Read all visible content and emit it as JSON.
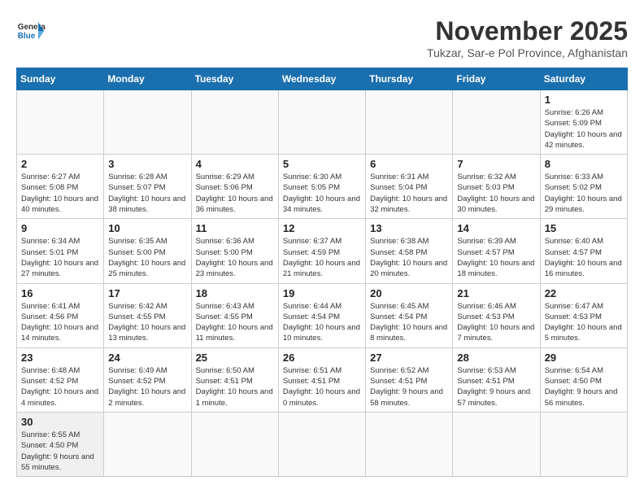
{
  "logo": {
    "general": "General",
    "blue": "Blue"
  },
  "title": "November 2025",
  "subtitle": "Tukzar, Sar-e Pol Province, Afghanistan",
  "days_of_week": [
    "Sunday",
    "Monday",
    "Tuesday",
    "Wednesday",
    "Thursday",
    "Friday",
    "Saturday"
  ],
  "weeks": [
    [
      {
        "day": "",
        "info": ""
      },
      {
        "day": "",
        "info": ""
      },
      {
        "day": "",
        "info": ""
      },
      {
        "day": "",
        "info": ""
      },
      {
        "day": "",
        "info": ""
      },
      {
        "day": "",
        "info": ""
      },
      {
        "day": "1",
        "info": "Sunrise: 6:26 AM\nSunset: 5:09 PM\nDaylight: 10 hours and 42 minutes."
      }
    ],
    [
      {
        "day": "2",
        "info": "Sunrise: 6:27 AM\nSunset: 5:08 PM\nDaylight: 10 hours and 40 minutes."
      },
      {
        "day": "3",
        "info": "Sunrise: 6:28 AM\nSunset: 5:07 PM\nDaylight: 10 hours and 38 minutes."
      },
      {
        "day": "4",
        "info": "Sunrise: 6:29 AM\nSunset: 5:06 PM\nDaylight: 10 hours and 36 minutes."
      },
      {
        "day": "5",
        "info": "Sunrise: 6:30 AM\nSunset: 5:05 PM\nDaylight: 10 hours and 34 minutes."
      },
      {
        "day": "6",
        "info": "Sunrise: 6:31 AM\nSunset: 5:04 PM\nDaylight: 10 hours and 32 minutes."
      },
      {
        "day": "7",
        "info": "Sunrise: 6:32 AM\nSunset: 5:03 PM\nDaylight: 10 hours and 30 minutes."
      },
      {
        "day": "8",
        "info": "Sunrise: 6:33 AM\nSunset: 5:02 PM\nDaylight: 10 hours and 29 minutes."
      }
    ],
    [
      {
        "day": "9",
        "info": "Sunrise: 6:34 AM\nSunset: 5:01 PM\nDaylight: 10 hours and 27 minutes."
      },
      {
        "day": "10",
        "info": "Sunrise: 6:35 AM\nSunset: 5:00 PM\nDaylight: 10 hours and 25 minutes."
      },
      {
        "day": "11",
        "info": "Sunrise: 6:36 AM\nSunset: 5:00 PM\nDaylight: 10 hours and 23 minutes."
      },
      {
        "day": "12",
        "info": "Sunrise: 6:37 AM\nSunset: 4:59 PM\nDaylight: 10 hours and 21 minutes."
      },
      {
        "day": "13",
        "info": "Sunrise: 6:38 AM\nSunset: 4:58 PM\nDaylight: 10 hours and 20 minutes."
      },
      {
        "day": "14",
        "info": "Sunrise: 6:39 AM\nSunset: 4:57 PM\nDaylight: 10 hours and 18 minutes."
      },
      {
        "day": "15",
        "info": "Sunrise: 6:40 AM\nSunset: 4:57 PM\nDaylight: 10 hours and 16 minutes."
      }
    ],
    [
      {
        "day": "16",
        "info": "Sunrise: 6:41 AM\nSunset: 4:56 PM\nDaylight: 10 hours and 14 minutes."
      },
      {
        "day": "17",
        "info": "Sunrise: 6:42 AM\nSunset: 4:55 PM\nDaylight: 10 hours and 13 minutes."
      },
      {
        "day": "18",
        "info": "Sunrise: 6:43 AM\nSunset: 4:55 PM\nDaylight: 10 hours and 11 minutes."
      },
      {
        "day": "19",
        "info": "Sunrise: 6:44 AM\nSunset: 4:54 PM\nDaylight: 10 hours and 10 minutes."
      },
      {
        "day": "20",
        "info": "Sunrise: 6:45 AM\nSunset: 4:54 PM\nDaylight: 10 hours and 8 minutes."
      },
      {
        "day": "21",
        "info": "Sunrise: 6:46 AM\nSunset: 4:53 PM\nDaylight: 10 hours and 7 minutes."
      },
      {
        "day": "22",
        "info": "Sunrise: 6:47 AM\nSunset: 4:53 PM\nDaylight: 10 hours and 5 minutes."
      }
    ],
    [
      {
        "day": "23",
        "info": "Sunrise: 6:48 AM\nSunset: 4:52 PM\nDaylight: 10 hours and 4 minutes."
      },
      {
        "day": "24",
        "info": "Sunrise: 6:49 AM\nSunset: 4:52 PM\nDaylight: 10 hours and 2 minutes."
      },
      {
        "day": "25",
        "info": "Sunrise: 6:50 AM\nSunset: 4:51 PM\nDaylight: 10 hours and 1 minute."
      },
      {
        "day": "26",
        "info": "Sunrise: 6:51 AM\nSunset: 4:51 PM\nDaylight: 10 hours and 0 minutes."
      },
      {
        "day": "27",
        "info": "Sunrise: 6:52 AM\nSunset: 4:51 PM\nDaylight: 9 hours and 58 minutes."
      },
      {
        "day": "28",
        "info": "Sunrise: 6:53 AM\nSunset: 4:51 PM\nDaylight: 9 hours and 57 minutes."
      },
      {
        "day": "29",
        "info": "Sunrise: 6:54 AM\nSunset: 4:50 PM\nDaylight: 9 hours and 56 minutes."
      }
    ],
    [
      {
        "day": "30",
        "info": "Sunrise: 6:55 AM\nSunset: 4:50 PM\nDaylight: 9 hours and 55 minutes."
      },
      {
        "day": "",
        "info": ""
      },
      {
        "day": "",
        "info": ""
      },
      {
        "day": "",
        "info": ""
      },
      {
        "day": "",
        "info": ""
      },
      {
        "day": "",
        "info": ""
      },
      {
        "day": "",
        "info": ""
      }
    ]
  ]
}
